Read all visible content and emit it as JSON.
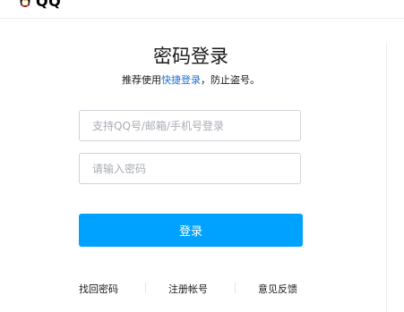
{
  "header": {
    "logo_text": "QQ",
    "logo_icon": "qq-penguin-icon"
  },
  "login": {
    "title": "密码登录",
    "subtitle_prefix": "推荐使用",
    "subtitle_link": "快捷登录",
    "subtitle_suffix": "，防止盗号。",
    "account_placeholder": "支持QQ号/邮箱/手机号登录",
    "password_placeholder": "请输入密码",
    "login_button": "登录"
  },
  "footer_links": {
    "find_password": "找回密码",
    "register": "注册帐号",
    "feedback": "意见反馈"
  },
  "colors": {
    "accent": "#00a2ff",
    "link": "#1e6fd6"
  }
}
